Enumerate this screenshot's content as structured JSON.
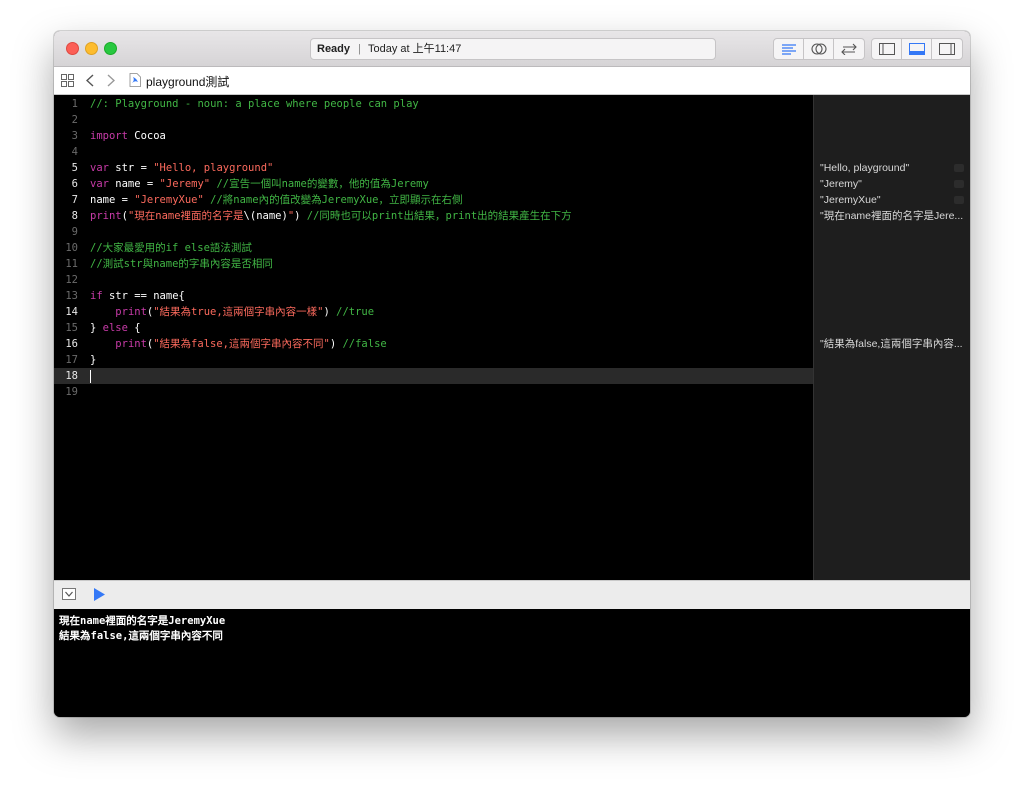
{
  "window": {
    "status_ready": "Ready",
    "status_sep": "|",
    "status_time": "Today at 上午11:47"
  },
  "nav": {
    "file_name": "playground測試"
  },
  "editor": {
    "lines": [
      {
        "n": "1",
        "tokens": [
          {
            "t": "//: Playground - noun: a place where people can play",
            "c": "comment"
          }
        ]
      },
      {
        "n": "2",
        "tokens": []
      },
      {
        "n": "3",
        "tokens": [
          {
            "t": "import",
            "c": "kw"
          },
          {
            "t": " Cocoa",
            "c": "plain"
          }
        ]
      },
      {
        "n": "4",
        "tokens": []
      },
      {
        "n": "5",
        "tokens": [
          {
            "t": "var",
            "c": "kw"
          },
          {
            "t": " str = ",
            "c": "plain"
          },
          {
            "t": "\"Hello, playground\"",
            "c": "str"
          }
        ]
      },
      {
        "n": "6",
        "tokens": [
          {
            "t": "var",
            "c": "kw"
          },
          {
            "t": " name = ",
            "c": "plain"
          },
          {
            "t": "\"Jeremy\"",
            "c": "str"
          },
          {
            "t": " //宣告一個叫name的變數，他的值為Jeremy",
            "c": "comment"
          }
        ]
      },
      {
        "n": "7",
        "tokens": [
          {
            "t": "name = ",
            "c": "plain"
          },
          {
            "t": "\"JeremyXue\"",
            "c": "str"
          },
          {
            "t": " //將name內的值改變為JeremyXue，立即顯示在右側",
            "c": "comment"
          }
        ]
      },
      {
        "n": "8",
        "tokens": [
          {
            "t": "print",
            "c": "kw"
          },
          {
            "t": "(",
            "c": "plain"
          },
          {
            "t": "\"現在name裡面的名字是",
            "c": "str"
          },
          {
            "t": "\\(name)",
            "c": "plain"
          },
          {
            "t": "\"",
            "c": "str"
          },
          {
            "t": ")",
            "c": "plain"
          },
          {
            "t": " //同時也可以print出結果，print出的結果產生在下方",
            "c": "comment"
          }
        ]
      },
      {
        "n": "9",
        "tokens": []
      },
      {
        "n": "10",
        "tokens": [
          {
            "t": "//大家最愛用的if else語法測試",
            "c": "comment"
          }
        ]
      },
      {
        "n": "11",
        "tokens": [
          {
            "t": "//測試str與name的字串內容是否相同",
            "c": "comment"
          }
        ]
      },
      {
        "n": "12",
        "tokens": []
      },
      {
        "n": "13",
        "tokens": [
          {
            "t": "if",
            "c": "kw"
          },
          {
            "t": " str == name{",
            "c": "plain"
          }
        ]
      },
      {
        "n": "14",
        "tokens": [
          {
            "t": "    ",
            "c": "plain"
          },
          {
            "t": "print",
            "c": "kw"
          },
          {
            "t": "(",
            "c": "plain"
          },
          {
            "t": "\"結果為true,這兩個字串內容一樣\"",
            "c": "str"
          },
          {
            "t": ")",
            "c": "plain"
          },
          {
            "t": " //true",
            "c": "comment"
          }
        ]
      },
      {
        "n": "15",
        "tokens": [
          {
            "t": "} ",
            "c": "plain"
          },
          {
            "t": "else",
            "c": "kw"
          },
          {
            "t": " {",
            "c": "plain"
          }
        ]
      },
      {
        "n": "16",
        "tokens": [
          {
            "t": "    ",
            "c": "plain"
          },
          {
            "t": "print",
            "c": "kw"
          },
          {
            "t": "(",
            "c": "plain"
          },
          {
            "t": "\"結果為false,這兩個字串內容不同\"",
            "c": "str"
          },
          {
            "t": ")",
            "c": "plain"
          },
          {
            "t": " //false",
            "c": "comment"
          }
        ]
      },
      {
        "n": "17",
        "tokens": [
          {
            "t": "}",
            "c": "plain"
          }
        ]
      },
      {
        "n": "18",
        "tokens": [],
        "current": true
      },
      {
        "n": "19",
        "tokens": []
      }
    ],
    "highlighted_line_numbers": [
      "5",
      "6",
      "7",
      "8",
      "14",
      "16",
      "18"
    ]
  },
  "results": [
    {
      "line": 5,
      "text": "\"Hello, playground\""
    },
    {
      "line": 6,
      "text": "\"Jeremy\""
    },
    {
      "line": 7,
      "text": "\"JeremyXue\""
    },
    {
      "line": 8,
      "text": "\"現在name裡面的名字是Jere..."
    },
    {
      "line": 16,
      "text": "\"結果為false,這兩個字串內容..."
    }
  ],
  "console": {
    "lines": [
      "現在name裡面的名字是JeremyXue",
      "結果為false,這兩個字串內容不同"
    ]
  },
  "icons": {
    "close": "close-window",
    "minimize": "minimize-window",
    "zoom": "zoom-window",
    "editor_standard": "standard-editor-icon",
    "editor_assistant": "assistant-editor-icon",
    "editor_version": "version-editor-icon",
    "navigator": "navigator-panel-icon",
    "debug_area": "debug-area-icon",
    "utilities": "utilities-panel-icon",
    "grid": "related-items-icon",
    "back": "back-chevron-icon",
    "forward": "forward-chevron-icon",
    "file": "swift-file-icon",
    "hide_debug": "hide-debug-icon",
    "run": "run-play-icon"
  },
  "colors": {
    "comment": "#41b645",
    "keyword": "#c83ba8",
    "string": "#fc6a5d",
    "accent_blue": "#3478f6"
  }
}
